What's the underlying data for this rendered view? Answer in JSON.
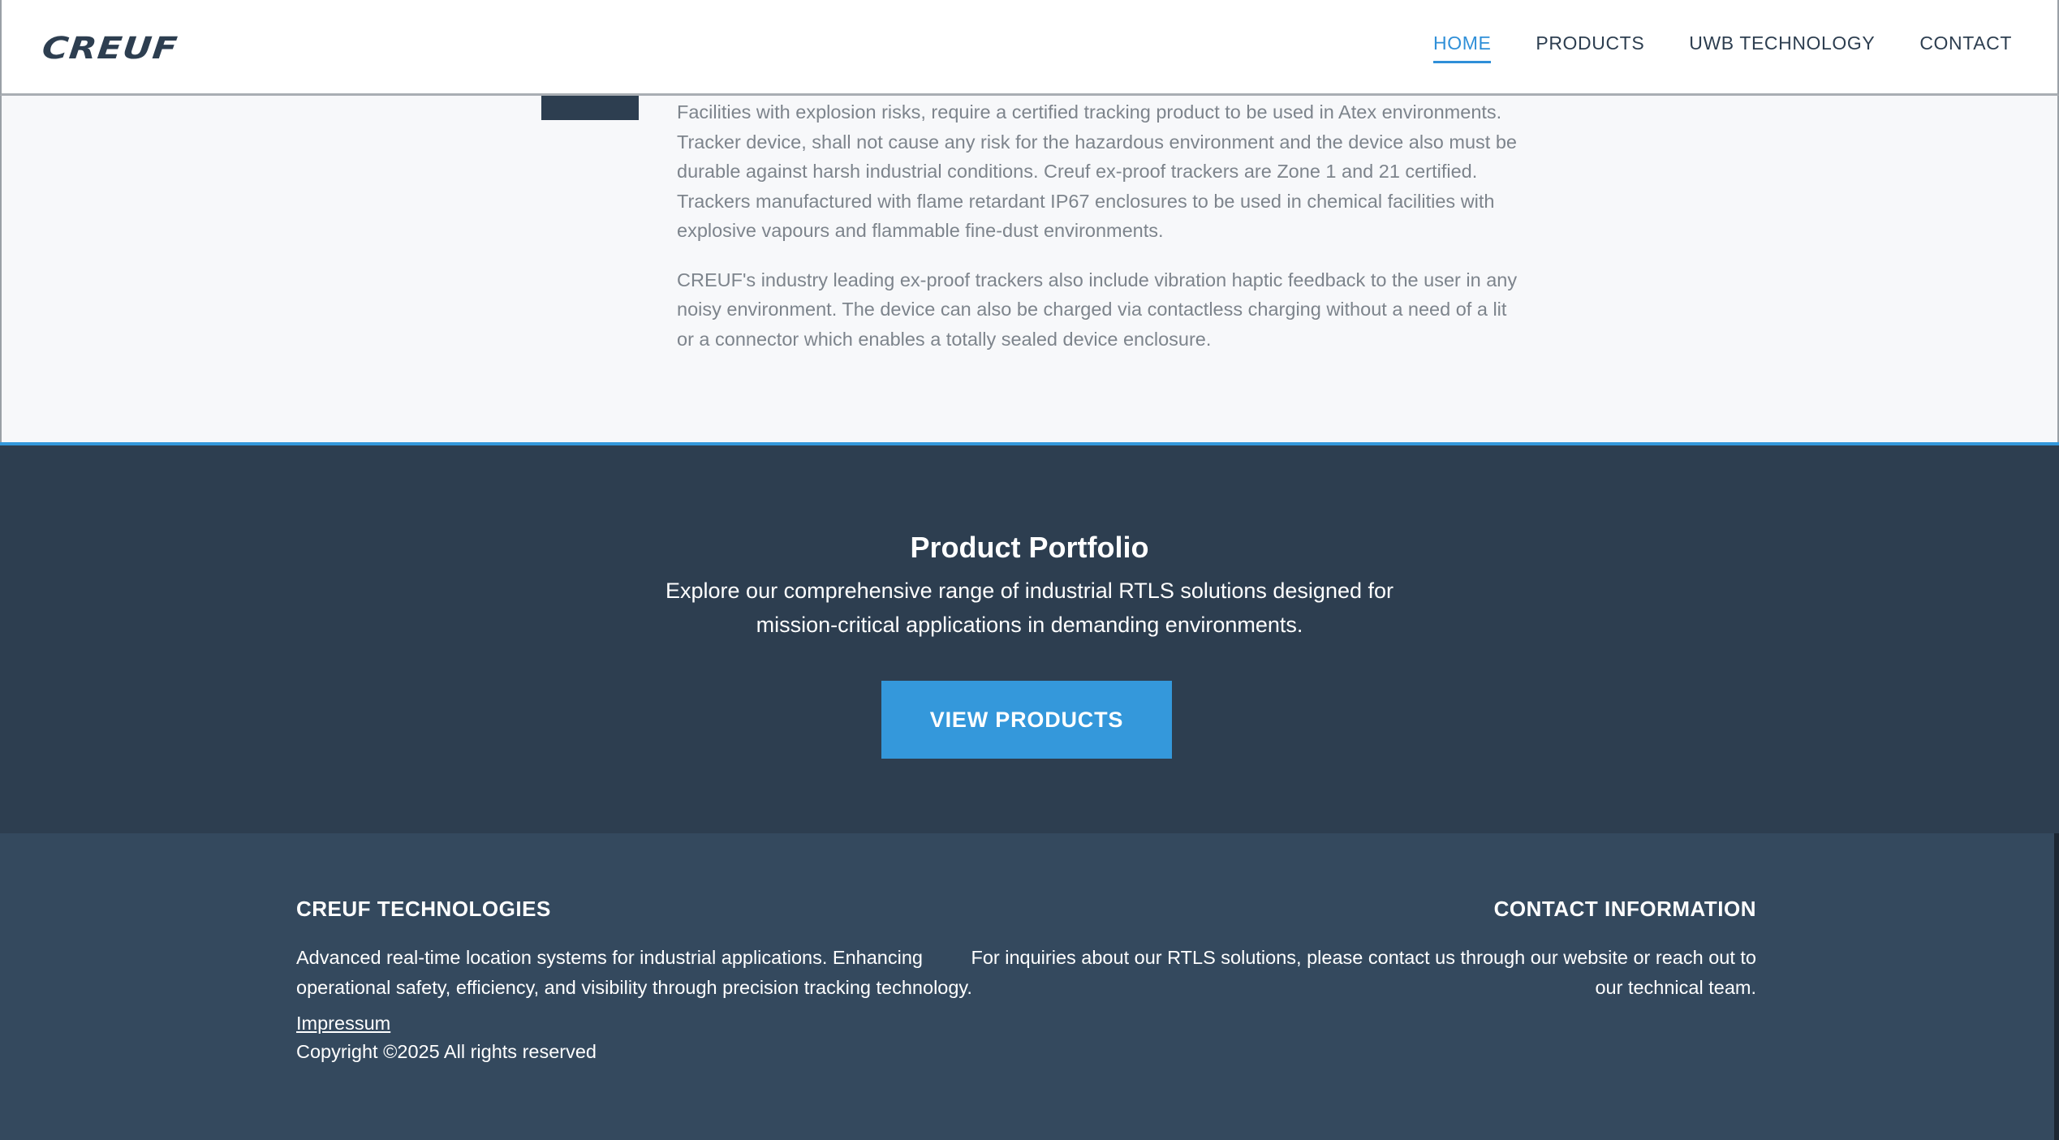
{
  "header": {
    "logo_text": "CREUF",
    "nav": [
      {
        "label": "HOME",
        "active": true
      },
      {
        "label": "PRODUCTS",
        "active": false
      },
      {
        "label": "UWB TECHNOLOGY",
        "active": false
      },
      {
        "label": "CONTACT",
        "active": false
      }
    ]
  },
  "content": {
    "paragraph_1": "Facilities with explosion risks, require a certified tracking product to be used in Atex environments. Tracker device, shall not cause any risk for the hazardous environment and the device also must be durable against harsh industrial conditions. Creuf ex-proof trackers are Zone 1 and 21 certified. Trackers manufactured with flame retardant IP67 enclosures to be used in chemical facilities with explosive vapours and flammable fine-dust environments.",
    "paragraph_2": "CREUF's industry leading ex-proof trackers also include vibration haptic feedback to the user in any noisy environment. The device can also be charged via contactless charging without a need of a lit or a connector which enables a totally sealed device enclosure."
  },
  "portfolio": {
    "title": "Product Portfolio",
    "subtitle": "Explore our comprehensive range of industrial RTLS solutions designed for mission-critical applications in demanding environments.",
    "button_label": "VIEW PRODUCTS"
  },
  "footer": {
    "left": {
      "heading": "CREUF TECHNOLOGIES",
      "text": "Advanced real-time location systems for industrial applications. Enhancing operational safety, efficiency, and visibility through precision tracking technology.",
      "link": "Impressum",
      "copyright": "Copyright ©2025 All rights reserved"
    },
    "right": {
      "heading": "CONTACT INFORMATION",
      "text": "For inquiries about our RTLS solutions, please contact us through our website or reach out to our technical team."
    }
  },
  "colors": {
    "brand_dark": "#2d3e50",
    "accent": "#3498db",
    "footer_bg": "#34495e"
  }
}
